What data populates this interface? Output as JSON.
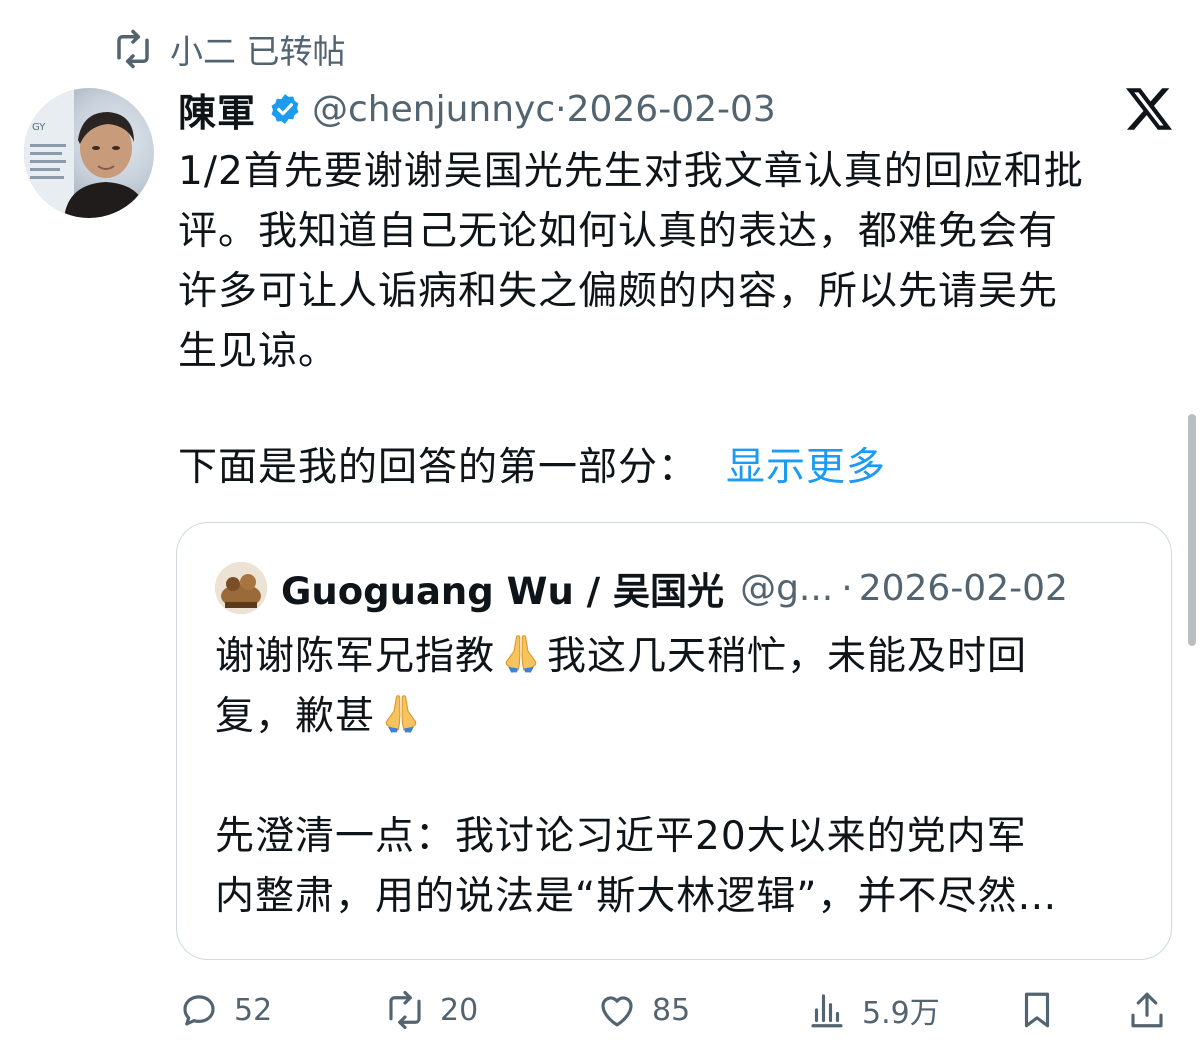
{
  "repost": {
    "text": "小二 已转帖"
  },
  "tweet": {
    "display_name": "陳軍",
    "handle": "@chenjunnyc",
    "separator": "·",
    "date": "2026-02-03",
    "text": "1/2首先要谢谢吴国光先生对我文章认真的回应和批\n评。我知道自己无论如何认真的表达，都难免会有\n许多可让人诟病和失之偏颇的内容，所以先请吴先\n生见谅。",
    "more_prefix": "下面是我的回答的第一部分：",
    "show_more": "显示更多"
  },
  "quote": {
    "display_name": "Guoguang Wu / 吴国光",
    "handle": "@g...",
    "separator": "·",
    "date": "2026-02-02",
    "text_line1_a": "谢谢陈军兄指教",
    "text_line1_b": "我这几天稍忙，未能及时回",
    "text_line2_a": "复，歉甚",
    "text_para2": "先澄清一点：我讨论习近平20大以来的党内军\n内整肃，用的说法是“斯大林逻辑”，并不尽然…"
  },
  "actions": {
    "replies": "52",
    "reposts": "20",
    "likes": "85",
    "views": "5.9万"
  },
  "icons": {
    "repost": "repost-icon",
    "verified": "verified-badge-icon",
    "x_logo": "x-logo-icon",
    "reply": "reply-icon",
    "like": "heart-icon",
    "views": "views-icon",
    "bookmark": "bookmark-icon",
    "share": "share-icon",
    "emoji": "folded-hands-emoji"
  },
  "colors": {
    "accent": "#1d9bf0",
    "secondary": "#536471",
    "text": "#0f1419",
    "border": "#cfd9de"
  }
}
